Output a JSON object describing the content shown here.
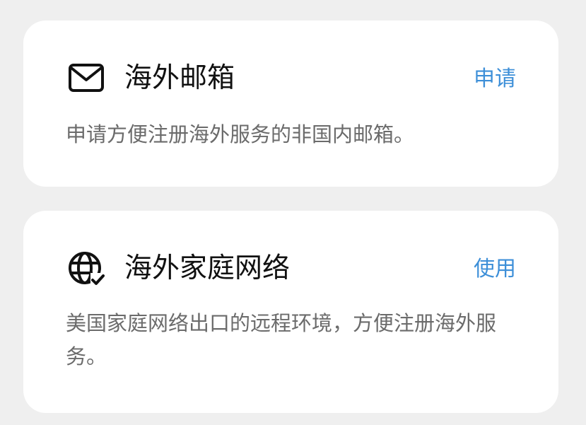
{
  "cards": [
    {
      "icon": "mail-icon",
      "title": "海外邮箱",
      "action": "申请",
      "description": "申请方便注册海外服务的非国内邮箱。"
    },
    {
      "icon": "globe-check-icon",
      "title": "海外家庭网络",
      "action": "使用",
      "description": "美国家庭网络出口的远程环境，方便注册海外服务。"
    }
  ],
  "colors": {
    "background": "#efefef",
    "card": "#ffffff",
    "accent": "#3d8fd8",
    "title": "#111111",
    "description": "#6b6b6b"
  }
}
